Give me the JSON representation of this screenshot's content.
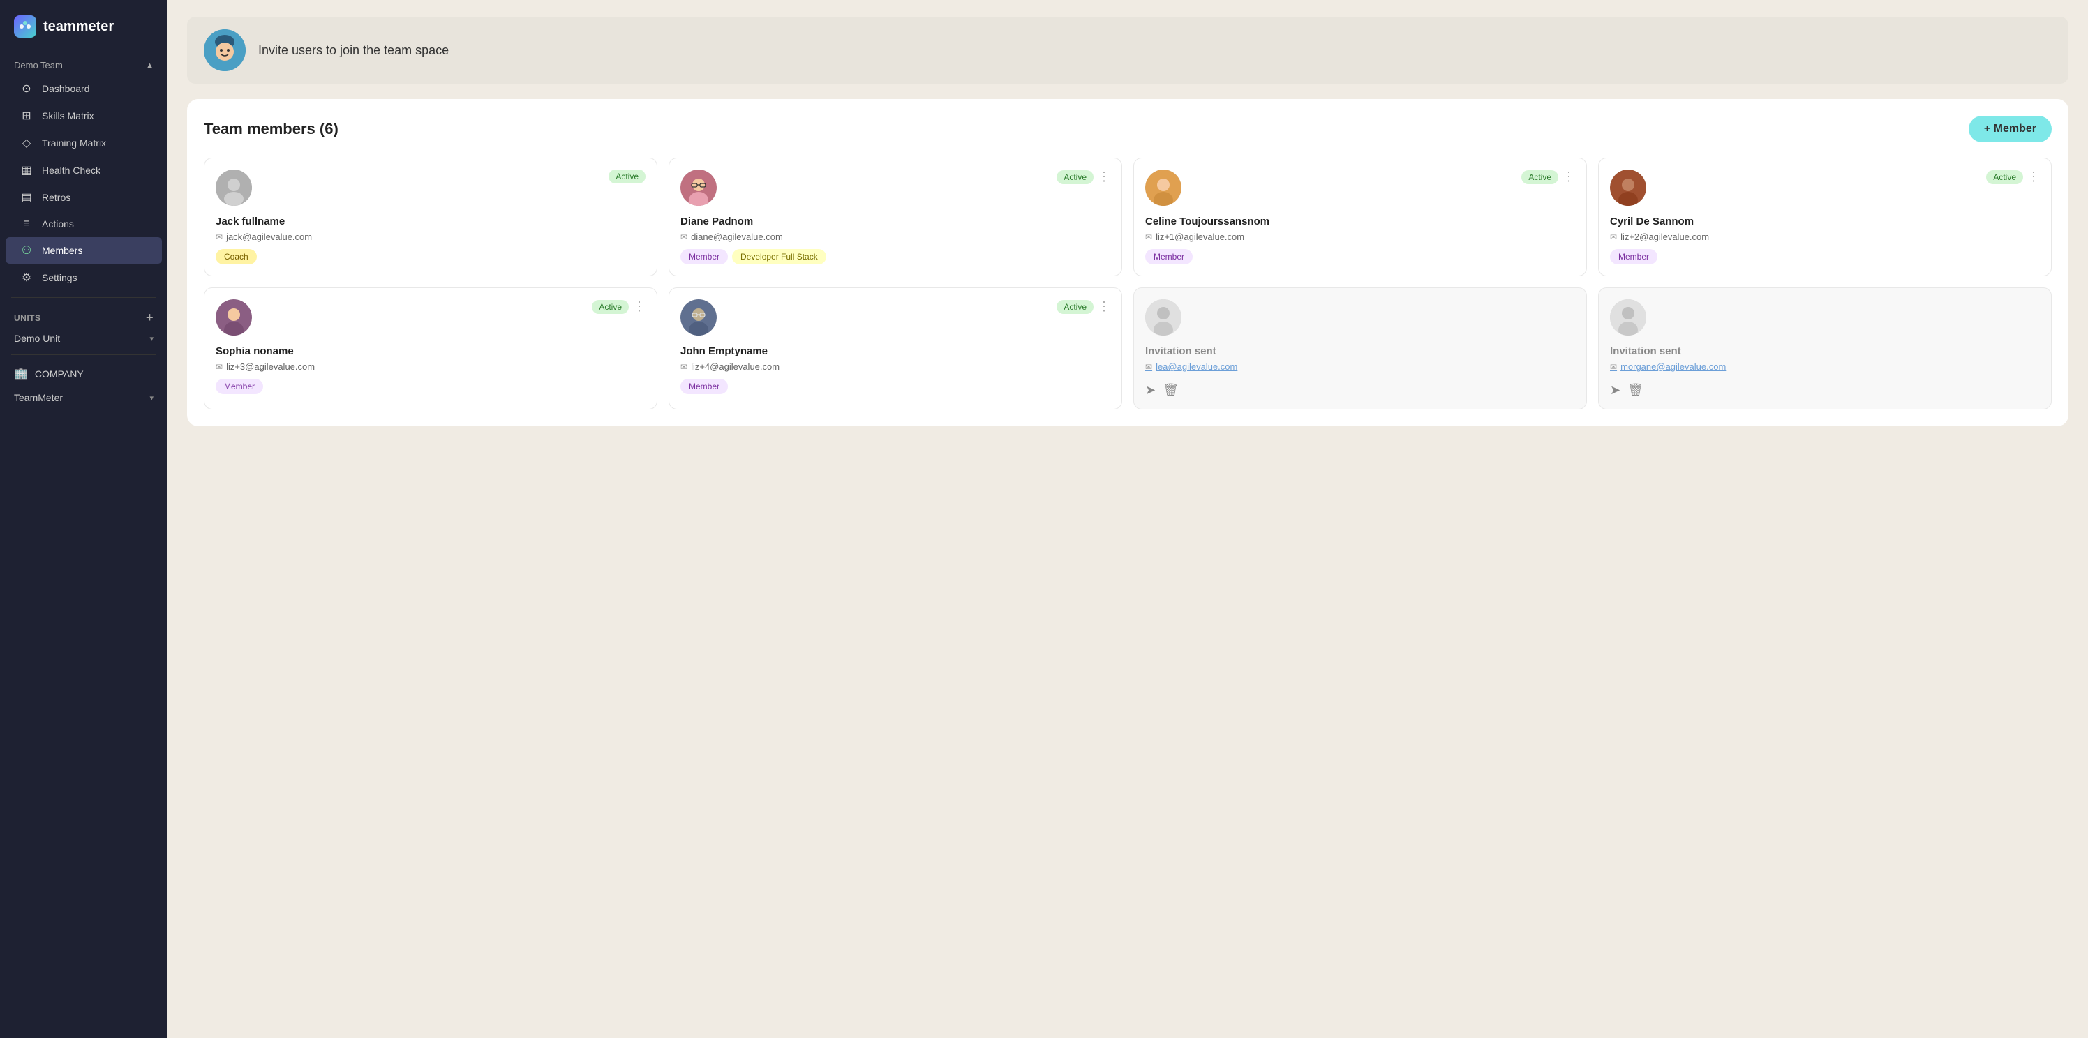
{
  "app": {
    "name": "teammeter",
    "logo_char": "t:"
  },
  "sidebar": {
    "team_name": "Demo Team",
    "nav_items": [
      {
        "id": "dashboard",
        "label": "Dashboard",
        "icon": "⊙",
        "active": false
      },
      {
        "id": "skills-matrix",
        "label": "Skills Matrix",
        "icon": "⊞",
        "active": false
      },
      {
        "id": "training-matrix",
        "label": "Training Matrix",
        "icon": "◇",
        "active": false
      },
      {
        "id": "health-check",
        "label": "Health Check",
        "icon": "▦",
        "active": false
      },
      {
        "id": "retros",
        "label": "Retros",
        "icon": "▤",
        "active": false
      },
      {
        "id": "actions",
        "label": "Actions",
        "icon": "≡",
        "active": false
      },
      {
        "id": "members",
        "label": "Members",
        "icon": "⚇",
        "active": true
      },
      {
        "id": "settings",
        "label": "Settings",
        "icon": "⚙",
        "active": false
      }
    ],
    "units_label": "UNITS",
    "units_add": "+",
    "demo_unit": "Demo Unit",
    "company_label": "COMPANY",
    "company_nav": "TeamMeter"
  },
  "invite_banner": {
    "text": "Invite users to join the team space"
  },
  "team_section": {
    "title": "Team members (6)",
    "add_button_label": "+ Member"
  },
  "members": [
    {
      "id": 1,
      "name": "Jack fullname",
      "email": "jack@agilevalue.com",
      "status": "Active",
      "roles": [
        "Coach"
      ],
      "pending": false,
      "avatar_color": "#b0b0b0"
    },
    {
      "id": 2,
      "name": "Diane Padnom",
      "email": "diane@agilevalue.com",
      "status": "Active",
      "roles": [
        "Member",
        "Developer Full Stack"
      ],
      "pending": false,
      "avatar_color": "#c06060"
    },
    {
      "id": 3,
      "name": "Celine Toujourssansnom",
      "email": "liz+1@agilevalue.com",
      "status": "Active",
      "roles": [
        "Member"
      ],
      "pending": false,
      "avatar_color": "#e0a050"
    },
    {
      "id": 4,
      "name": "Cyril De Sannom",
      "email": "liz+2@agilevalue.com",
      "status": "Active",
      "roles": [
        "Member"
      ],
      "pending": false,
      "avatar_color": "#a05030"
    },
    {
      "id": 5,
      "name": "Sophia noname",
      "email": "liz+3@agilevalue.com",
      "status": "Active",
      "roles": [
        "Member"
      ],
      "pending": false,
      "avatar_color": "#8b5e83"
    },
    {
      "id": 6,
      "name": "John Emptyname",
      "email": "liz+4@agilevalue.com",
      "status": "Active",
      "roles": [
        "Member"
      ],
      "pending": false,
      "avatar_color": "#607090"
    },
    {
      "id": 7,
      "name": "Invitation sent",
      "email": "lea@agilevalue.com",
      "status": null,
      "roles": [],
      "pending": true
    },
    {
      "id": 8,
      "name": "Invitation sent",
      "email": "morgane@agilevalue.com",
      "status": null,
      "roles": [],
      "pending": true
    }
  ]
}
